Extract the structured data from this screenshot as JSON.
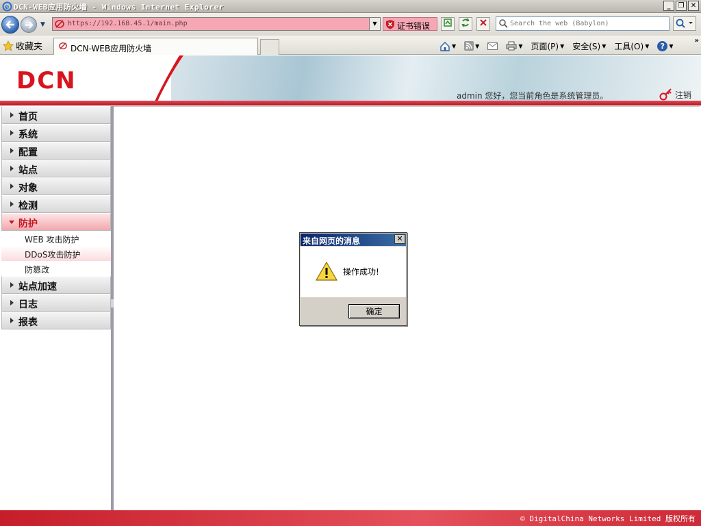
{
  "window": {
    "title": "DCN-WEB应用防火墙 - Windows Internet Explorer",
    "minimize": "_",
    "maximize": "❐",
    "close": "✕"
  },
  "navbar": {
    "url": "https://192.168.45.1/main.php",
    "cert_error": "证书错误",
    "search_placeholder": "Search the web (Babylon)"
  },
  "favbar": {
    "favorites": "收藏夹",
    "tab_title": "DCN-WEB应用防火墙",
    "page_menu": "页面(P)",
    "safety_menu": "安全(S)",
    "tools_menu": "工具(O)",
    "help_menu": "?"
  },
  "header": {
    "logo": "DCN",
    "user_greeting": "admin 您好，您当前角色是系统管理员。",
    "logout": "注销"
  },
  "sidebar": {
    "items": [
      {
        "label": "首页"
      },
      {
        "label": "系统"
      },
      {
        "label": "配置"
      },
      {
        "label": "站点"
      },
      {
        "label": "对象"
      },
      {
        "label": "检测"
      },
      {
        "label": "防护",
        "active": true,
        "children": [
          {
            "label": "WEB 攻击防护"
          },
          {
            "label": "DDoS攻击防护",
            "highlighted": true
          },
          {
            "label": "防篡改"
          }
        ]
      },
      {
        "label": "站点加速"
      },
      {
        "label": "日志"
      },
      {
        "label": "报表"
      }
    ]
  },
  "dialog": {
    "title": "来自网页的消息",
    "message": "操作成功!",
    "ok": "确定",
    "close": "✕"
  },
  "footer": {
    "copyright": "© DigitalChina Networks Limited 版权所有"
  },
  "colors": {
    "brand_red": "#d8141e",
    "titlebar_blue": "#0a246a"
  }
}
